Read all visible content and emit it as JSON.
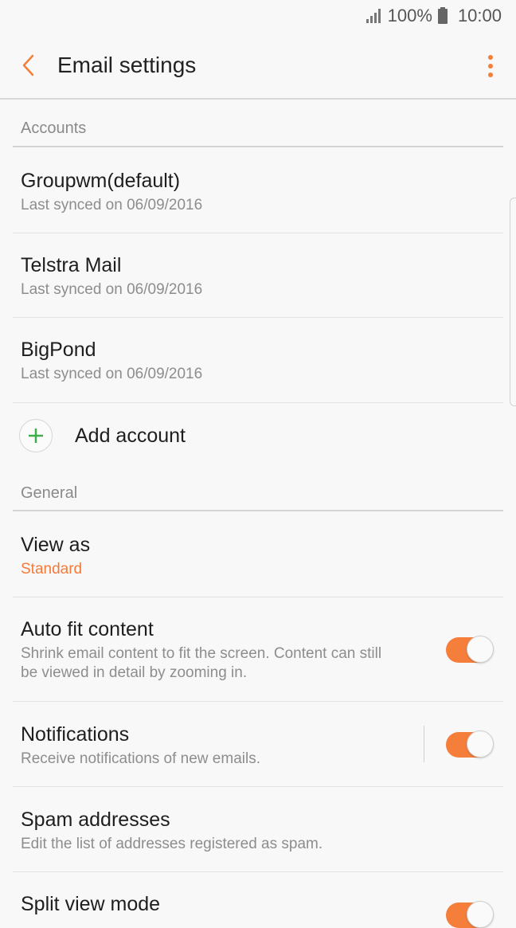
{
  "status": {
    "battery": "100%",
    "time": "10:00"
  },
  "header": {
    "title": "Email settings"
  },
  "accounts": {
    "section_label": "Accounts",
    "items": [
      {
        "name": "Groupwm(default)",
        "sync": "Last synced on 06/09/2016"
      },
      {
        "name": "Telstra Mail",
        "sync": "Last synced on 06/09/2016"
      },
      {
        "name": "BigPond",
        "sync": "Last synced on 06/09/2016"
      }
    ],
    "add_label": "Add account"
  },
  "general": {
    "section_label": "General",
    "view_as": {
      "title": "View as",
      "value": "Standard"
    },
    "auto_fit": {
      "title": "Auto fit content",
      "desc_line1": "Shrink email content to fit the screen. Content can still",
      "desc_line2": "be viewed in detail by zooming in.",
      "enabled": true
    },
    "notifications": {
      "title": "Notifications",
      "desc": "Receive notifications of new emails.",
      "enabled": true
    },
    "spam": {
      "title": "Spam addresses",
      "desc": "Edit the list of addresses registered as spam."
    },
    "split_view": {
      "title": "Split view mode",
      "enabled": true
    }
  },
  "colors": {
    "accent": "#f57e3a",
    "add_icon": "#3fae49"
  },
  "icons": [
    "signal-icon",
    "battery-icon",
    "back-arrow-icon",
    "more-options-icon",
    "add-icon"
  ]
}
